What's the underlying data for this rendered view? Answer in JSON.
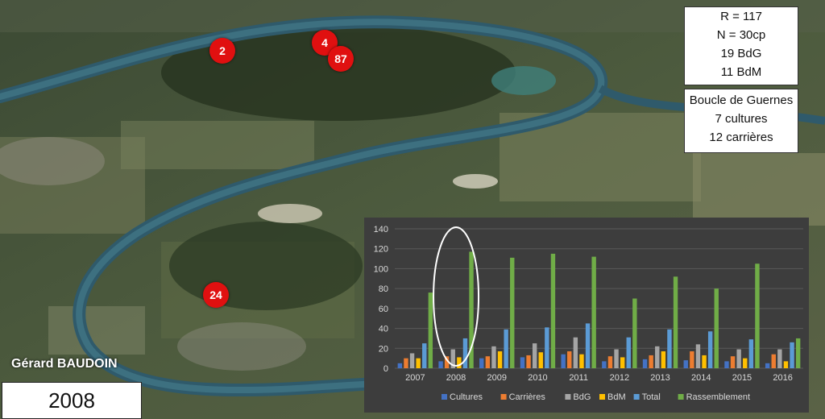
{
  "author": "Gérard BAUDOIN",
  "year_label": "2008",
  "markers": [
    {
      "label": "2"
    },
    {
      "label": "4"
    },
    {
      "label": "87"
    },
    {
      "label": "24"
    }
  ],
  "stats_box": {
    "lines": [
      "R = 117",
      "N = 30cp",
      "19 BdG",
      "11 BdM"
    ]
  },
  "site_box": {
    "lines": [
      "Boucle de Guernes",
      "7 cultures",
      "12 carrières"
    ]
  },
  "colors": {
    "marker": "#e01010",
    "Cultures": "#4472c4",
    "Carrières": "#ed7d31",
    "BdG": "#a5a5a5",
    "BdM": "#ffc000",
    "Total": "#5b9bd5",
    "Rassemblement": "#70ad47"
  },
  "chart_data": {
    "type": "bar",
    "title": "",
    "xlabel": "",
    "ylabel": "",
    "ylim": [
      0,
      140
    ],
    "yticks": [
      0,
      20,
      40,
      60,
      80,
      100,
      120,
      140
    ],
    "grid": true,
    "legend": "bottom",
    "highlight_category": "2008",
    "categories": [
      "2007",
      "2008",
      "2009",
      "2010",
      "2011",
      "2012",
      "2013",
      "2014",
      "2015",
      "2016"
    ],
    "series": [
      {
        "name": "Cultures",
        "values": [
          5,
          7,
          10,
          11,
          14,
          7,
          9,
          8,
          7,
          5
        ]
      },
      {
        "name": "Carrières",
        "values": [
          10,
          12,
          12,
          13,
          17,
          12,
          13,
          17,
          12,
          14
        ]
      },
      {
        "name": "BdG",
        "values": [
          15,
          19,
          22,
          25,
          31,
          19,
          22,
          24,
          19,
          19
        ]
      },
      {
        "name": "BdM",
        "values": [
          10,
          11,
          17,
          16,
          14,
          11,
          17,
          13,
          10,
          7
        ]
      },
      {
        "name": "Total",
        "values": [
          25,
          30,
          39,
          41,
          45,
          31,
          39,
          37,
          29,
          26
        ]
      },
      {
        "name": "Rassemblement",
        "values": [
          76,
          117,
          111,
          115,
          112,
          70,
          92,
          80,
          105,
          30
        ]
      }
    ]
  }
}
